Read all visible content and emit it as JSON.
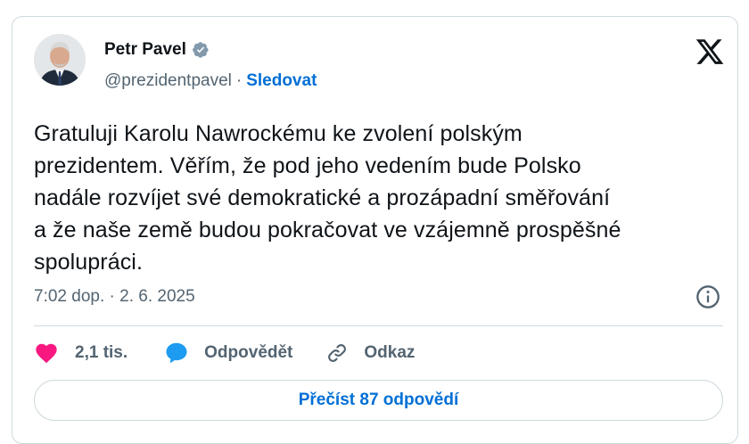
{
  "author": {
    "name": "Petr Pavel",
    "handle": "@prezidentpavel",
    "separator": "·",
    "follow_label": "Sledovat",
    "verified_icon": "verified-badge-icon"
  },
  "tweet": {
    "text": "Gratuluji Karolu Nawrockému ke zvolení polským\nprezidentem. Věřím, že pod jeho vedením bude Polsko\nnadále rozvíjet své demokratické a prozápadní směřování\na že naše země budou pokračovat ve vzájemně prospěšné\nspolupráci.",
    "timestamp": "7:02 dop. · 2. 6. 2025"
  },
  "actions": {
    "like_count": "2,1 tis.",
    "reply_label": "Odpovědět",
    "link_label": "Odkaz"
  },
  "read_replies_label": "Přečíst 87 odpovědí",
  "colors": {
    "accent": "#006fd6",
    "like": "#f91880",
    "reply": "#1d9bf0",
    "muted": "#536471",
    "border": "#cfd9de"
  }
}
